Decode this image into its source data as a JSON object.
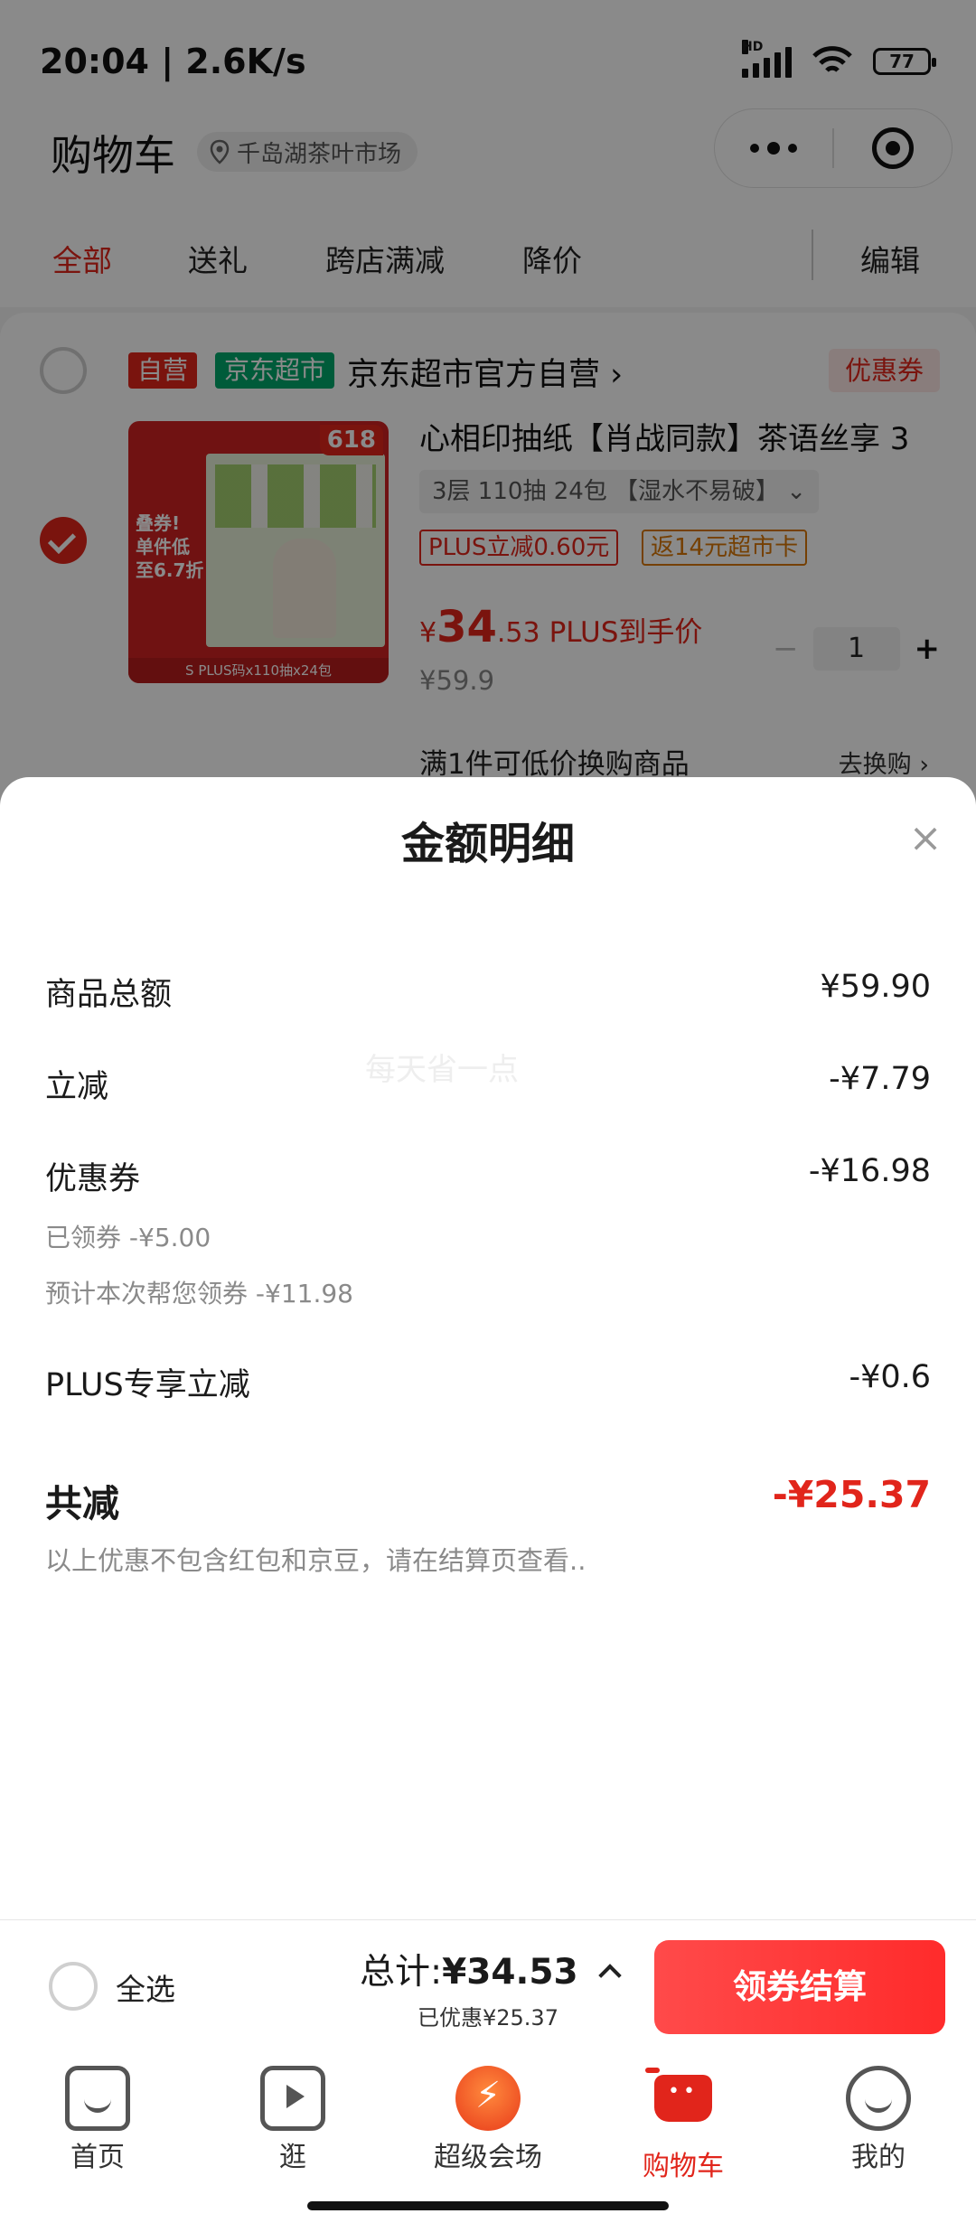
{
  "status_bar": {
    "time": "20:04 | 2.6K/s",
    "hd": "HD",
    "battery": "77"
  },
  "nav": {
    "title": "购物车",
    "location": "千岛湖茶叶市场"
  },
  "tabs": [
    {
      "label": "全部",
      "active": true
    },
    {
      "label": "送礼"
    },
    {
      "label": "跨店满减"
    },
    {
      "label": "降价"
    }
  ],
  "edit_label": "编辑",
  "shop": {
    "tag_self": "自营",
    "tag_market": "京东超市",
    "name": "京东超市官方自营 ›",
    "coupon": "优惠券"
  },
  "product": {
    "title": "心相印抽纸【肖战同款】茶语丝享 3",
    "spec": "3层 110抽 24包 【湿水不易破】 ⌄",
    "promo_plus": "PLUS立减0.60元",
    "promo_card": "返14元超市卡",
    "price_symbol": "¥",
    "price_int": "34",
    "price_dec": ".53",
    "price_suffix": "PLUS到手价",
    "original_price": "¥59.9",
    "quantity": "1",
    "minus": "−",
    "plus": "+",
    "thumb_badge": "618",
    "thumb_side": "叠券! 单件低至6.7折",
    "thumb_foot": "S PLUS码x110抽x24包",
    "trade_in": "满1件可低价换购商品",
    "trade_link": "去换购 ›"
  },
  "sheet": {
    "title": "金额明细",
    "close": "×",
    "watermark": "每天省一点",
    "rows": [
      {
        "label": "商品总额",
        "value": "¥59.90"
      },
      {
        "label": "立减",
        "value": "-¥7.79"
      },
      {
        "label": "优惠券",
        "value": "-¥16.98"
      },
      {
        "label": "PLUS专享立减",
        "value": "-¥0.6"
      }
    ],
    "coupon_claimed": "已领券 -¥5.00",
    "coupon_estimate": "预计本次帮您领券 -¥11.98",
    "total_label": "共减",
    "total_value": "-¥25.37",
    "note": "以上优惠不包含红包和京豆，请在结算页查看.."
  },
  "checkout": {
    "select_all": "全选",
    "total_prefix": "总计:",
    "total_value": "¥34.53",
    "saved": "已优惠¥25.37",
    "button": "领券结算"
  },
  "tabbar": [
    {
      "label": "首页",
      "icon": "home-icon"
    },
    {
      "label": "逛",
      "icon": "video-icon"
    },
    {
      "label": "超级会场",
      "icon": "super-venue-icon"
    },
    {
      "label": "购物车",
      "icon": "cart-icon",
      "active": true
    },
    {
      "label": "我的",
      "icon": "profile-icon"
    }
  ],
  "colors": {
    "accent": "#e1251b",
    "market_green": "#00a86b"
  }
}
